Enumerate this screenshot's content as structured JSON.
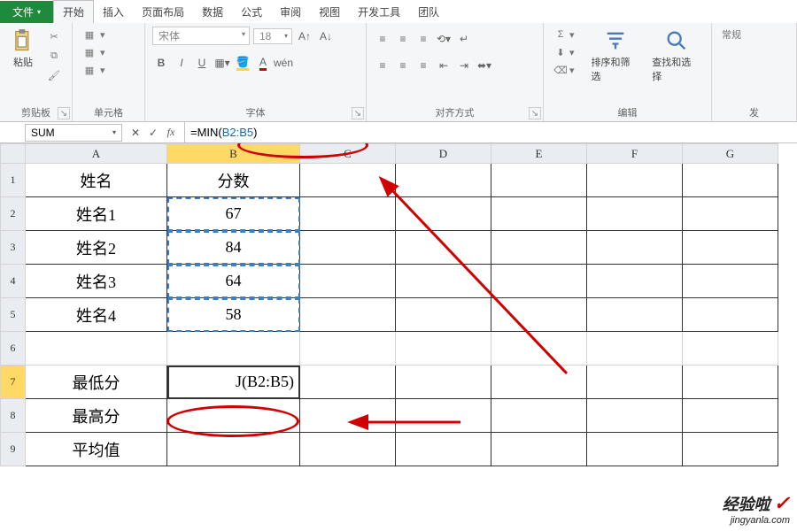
{
  "tabs": {
    "file": "文件",
    "home": "开始",
    "insert": "插入",
    "layout": "页面布局",
    "data": "数据",
    "formulas": "公式",
    "review": "审阅",
    "view": "视图",
    "dev": "开发工具",
    "team": "团队"
  },
  "ribbon_groups": {
    "clipboard": "剪贴板",
    "cells": "单元格",
    "font": "字体",
    "align": "对齐方式",
    "edit": "编辑",
    "right": "发"
  },
  "clipboard": {
    "paste": "粘贴"
  },
  "cells": {
    "A1": "姓名",
    "B1": "分数",
    "A2": "姓名1",
    "B2": "67",
    "A3": "姓名2",
    "B3": "84",
    "A4": "姓名3",
    "B4": "64",
    "A5": "姓名4",
    "B5": "58",
    "A7": "最低分",
    "B7": "J(B2:B5)",
    "A8": "最高分",
    "A9": "平均值"
  },
  "font": {
    "name": "宋体",
    "size": "18",
    "bold": "B",
    "italic": "I",
    "underline": "U"
  },
  "edit": {
    "sort": "排序和筛选",
    "find": "查找和选择",
    "changyong": "常规"
  },
  "namebox": "SUM",
  "formula_prefix": "=MIN(",
  "formula_ref": "B2:B5",
  "formula_suffix": ")",
  "cols": [
    "A",
    "B",
    "C",
    "D",
    "E",
    "F",
    "G"
  ],
  "rows": [
    "1",
    "2",
    "3",
    "4",
    "5",
    "6",
    "7",
    "8",
    "9"
  ],
  "watermark": {
    "l1": "经验啦",
    "l2": "jingyanla.com",
    "chk": "✓"
  },
  "chart_data": {
    "type": "table",
    "title": "分数",
    "columns": [
      "姓名",
      "分数"
    ],
    "rows": [
      [
        "姓名1",
        67
      ],
      [
        "姓名2",
        84
      ],
      [
        "姓名3",
        64
      ],
      [
        "姓名4",
        58
      ]
    ],
    "summary": {
      "最低分_formula": "=MIN(B2:B5)",
      "最高分": "",
      "平均值": ""
    }
  }
}
